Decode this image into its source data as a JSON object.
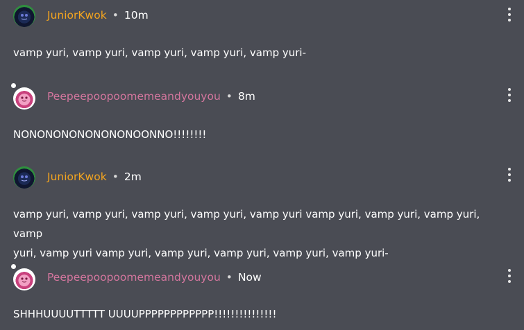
{
  "comments": [
    {
      "username": "JuniorKwok",
      "time": "10m",
      "text": "vamp yuri, vamp yuri, vamp yuri, vamp yuri, vamp yuri-",
      "name_color": "#f4a51f",
      "avatar": "green-dark-avatar"
    },
    {
      "username": "Peepeepoopoomemeandyouyou",
      "time": "8m",
      "text": "NONONONONONONONOONNO!!!!!!!!",
      "name_color": "#d4769e",
      "avatar": "pink-avatar"
    },
    {
      "username": "JuniorKwok",
      "time": "2m",
      "text_line1": "vamp yuri, vamp yuri, vamp yuri, vamp yuri, vamp yuri vamp yuri, vamp yuri, vamp yuri, vamp",
      "text_line2": "yuri, vamp yuri vamp yuri, vamp yuri, vamp yuri, vamp yuri, vamp yuri-",
      "name_color": "#f4a51f",
      "avatar": "green-dark-avatar"
    },
    {
      "username": "Peepeepoopoomemeandyouyou",
      "time": "Now",
      "text": "SHHHUUUUTTTTT UUUUPPPPPPPPPPPP!!!!!!!!!!!!!!!",
      "name_color": "#d4769e",
      "avatar": "pink-avatar"
    }
  ],
  "separator": "•",
  "icons": {
    "menu": "kebab-menu-icon"
  }
}
